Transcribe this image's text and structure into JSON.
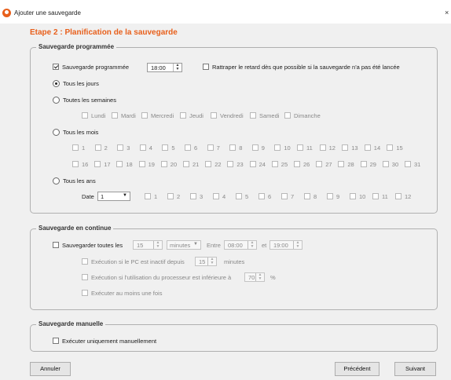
{
  "window": {
    "title": "Ajouter une sauvegarde",
    "close_glyph": "×"
  },
  "step_title": "Etape 2 :   Planification de la sauvegarde",
  "programmed": {
    "legend": "Sauvegarde programmée",
    "enabled_label": "Sauvegarde programmée",
    "time": "18:00",
    "catchup_label": "Rattraper le retard dès que possible si la sauvegarde n'a pas été lancée",
    "daily_label": "Tous les jours",
    "weekly_label": "Toutes les semaines",
    "weekdays": [
      "Lundi",
      "Mardi",
      "Mercredi",
      "Jeudi",
      "Vendredi",
      "Samedi",
      "Dimanche"
    ],
    "monthly_label": "Tous les mois",
    "month_days_row1": [
      "1",
      "2",
      "3",
      "4",
      "5",
      "6",
      "7",
      "8",
      "9",
      "10",
      "11",
      "12",
      "13",
      "14",
      "15"
    ],
    "month_days_row2": [
      "16",
      "17",
      "18",
      "19",
      "20",
      "21",
      "22",
      "23",
      "24",
      "25",
      "26",
      "27",
      "28",
      "29",
      "30",
      "31"
    ],
    "yearly_label": "Tous les ans",
    "date_label": "Date",
    "date_value": "1",
    "months": [
      "1",
      "2",
      "3",
      "4",
      "5",
      "6",
      "7",
      "8",
      "9",
      "10",
      "11",
      "12"
    ]
  },
  "continuous": {
    "legend": "Sauvegarde en continue",
    "every_label": "Sauvegarder toutes les",
    "every_value": "15",
    "unit_value": "minutes",
    "between_label": "Entre",
    "from_time": "08:00",
    "and_label": "et",
    "to_time": "19:00",
    "idle_label": "Exécution si le PC est inactif depuis",
    "idle_value": "15",
    "idle_unit": "minutes",
    "cpu_label": "Exécution si l'utilisation du processeur est inférieure à",
    "cpu_value": "70",
    "cpu_unit": "%",
    "once_label": "Exécuter au moins une fois"
  },
  "manual": {
    "legend": "Sauvegarde manuelle",
    "only_manual_label": "Exécuter uniquement manuellement"
  },
  "buttons": {
    "cancel": "Annuler",
    "previous": "Précédent",
    "next": "Suivant"
  },
  "colors": {
    "accent": "#e8601c"
  }
}
